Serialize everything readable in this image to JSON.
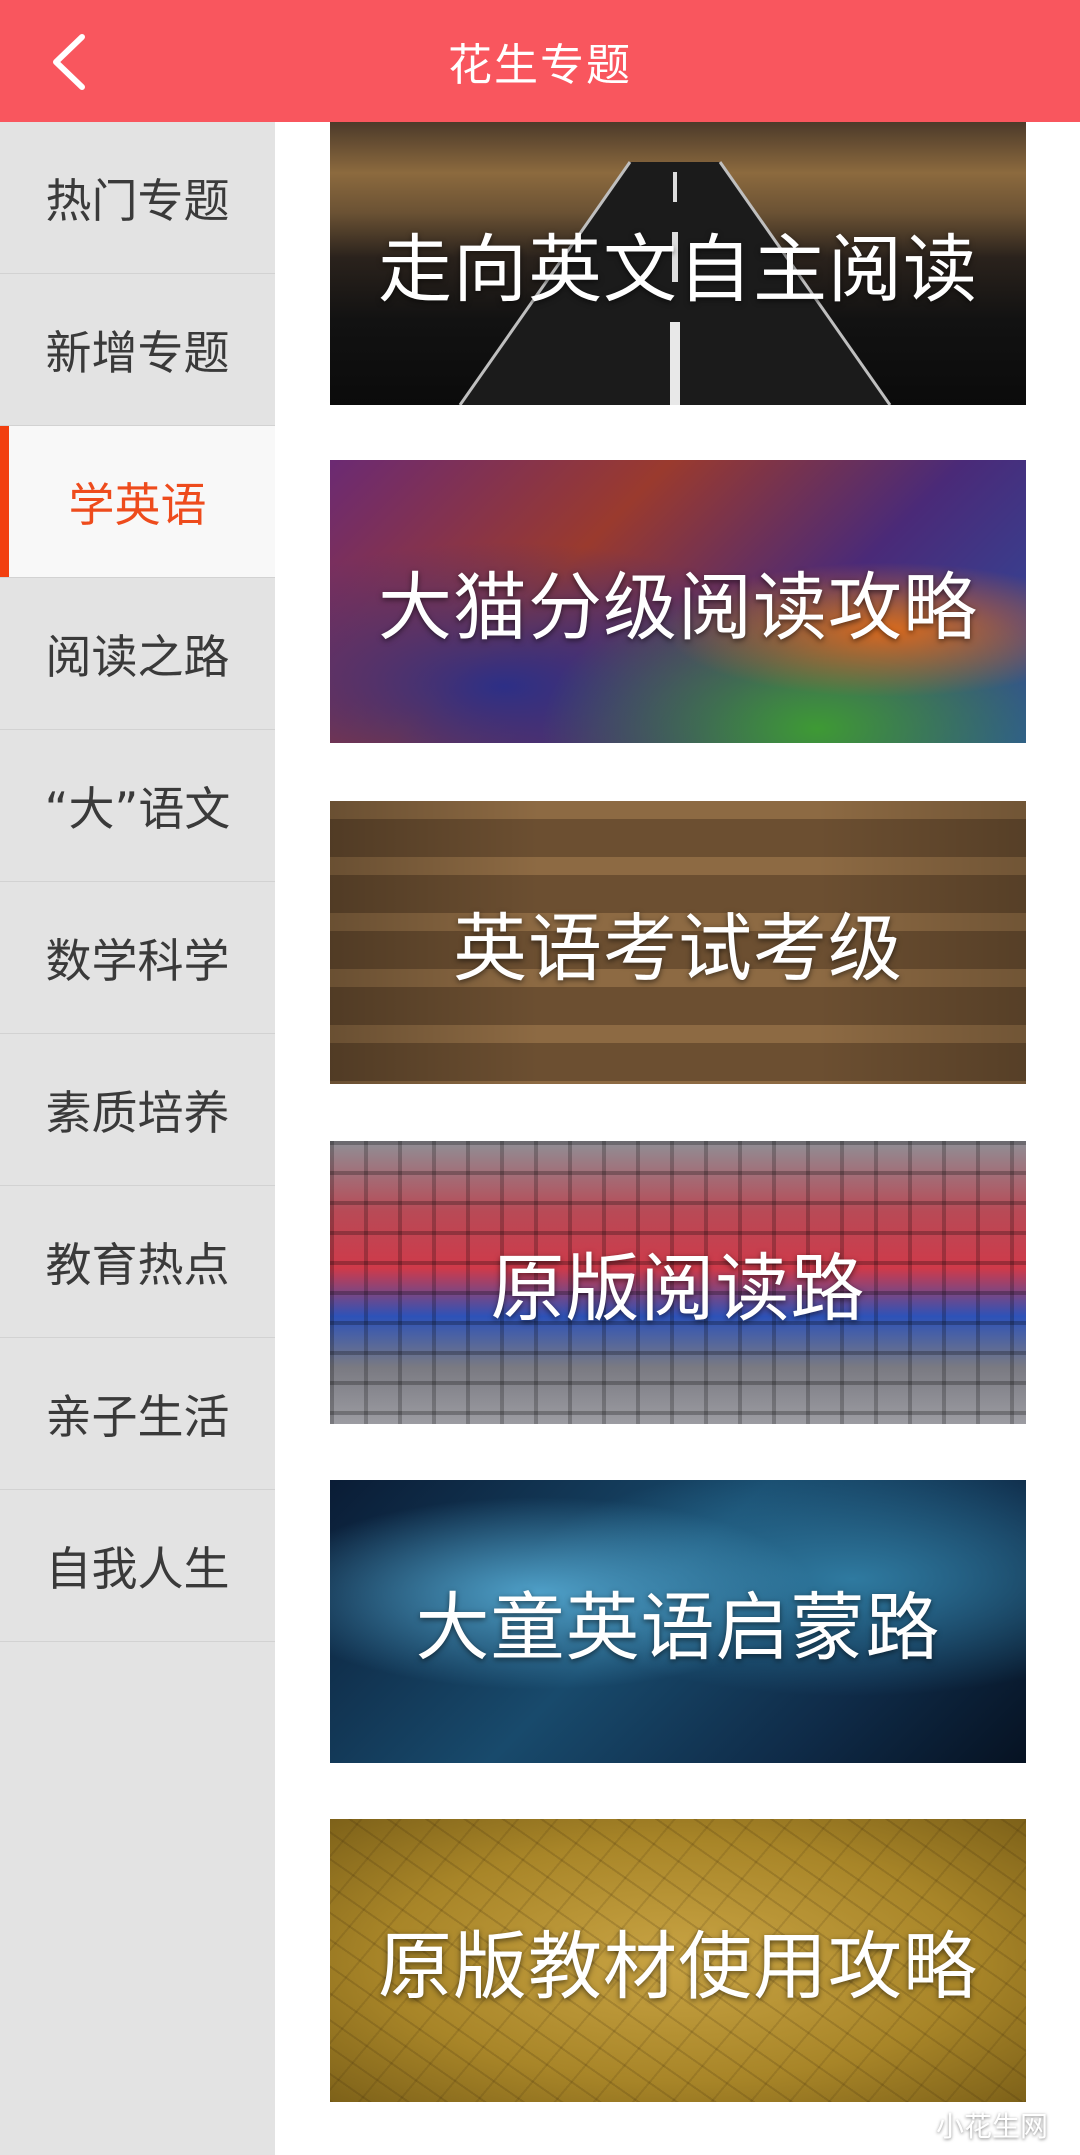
{
  "header": {
    "title": "花生专题",
    "back_icon": "chevron-left-icon",
    "bg_color": "#f9565e"
  },
  "sidebar": {
    "active_color": "#ee4b1c",
    "items": [
      {
        "label": "热门专题"
      },
      {
        "label": "新增专题"
      },
      {
        "label": "学英语",
        "active": true
      },
      {
        "label": "阅读之路"
      },
      {
        "label": "“大”语文"
      },
      {
        "label": "数学科学"
      },
      {
        "label": "素质培养"
      },
      {
        "label": "教育热点"
      },
      {
        "label": "亲子生活"
      },
      {
        "label": "自我人生"
      }
    ]
  },
  "cards": [
    {
      "title": "走向英文自主阅读"
    },
    {
      "title": "大猫分级阅读攻略"
    },
    {
      "title": "英语考试考级"
    },
    {
      "title": "原版阅读路"
    },
    {
      "title": "大童英语启蒙路"
    },
    {
      "title": "原版教材使用攻略"
    }
  ],
  "watermark": {
    "text": "小花生网",
    "icon": "wechat-icon"
  }
}
